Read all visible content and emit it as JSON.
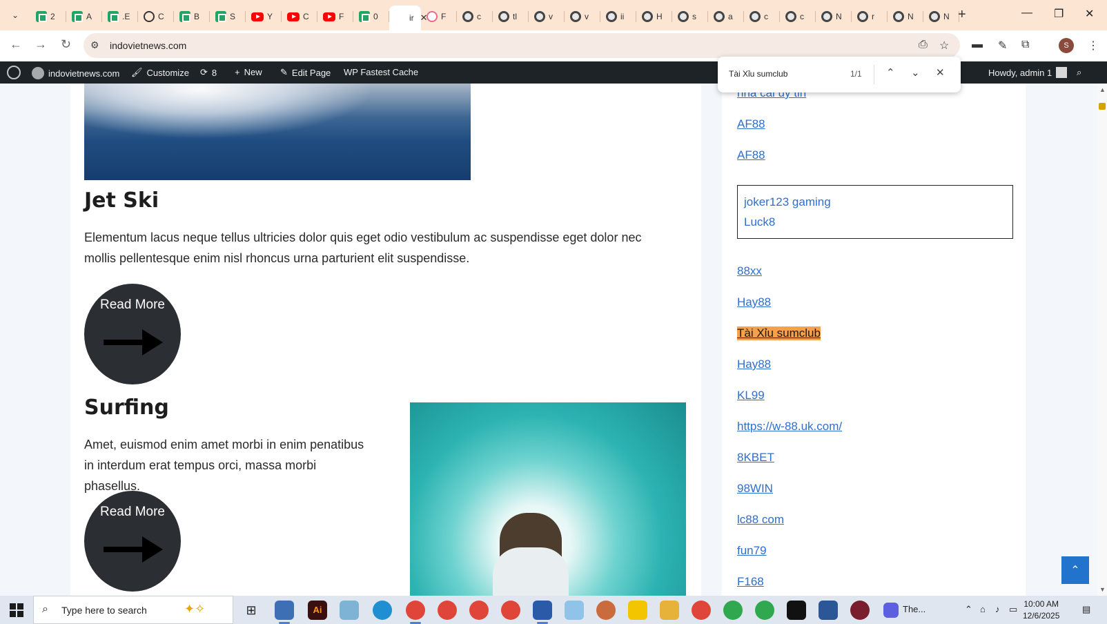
{
  "browser": {
    "tabs": [
      {
        "label": "2",
        "icon": "sheets-icon"
      },
      {
        "label": "A",
        "icon": "sheets-icon"
      },
      {
        "label": ".E",
        "icon": "sheets-icon"
      },
      {
        "label": "C",
        "icon": "chatgpt-icon"
      },
      {
        "label": "B",
        "icon": "sheets-icon"
      },
      {
        "label": "S",
        "icon": "sheets-icon"
      },
      {
        "label": "Y",
        "icon": "youtube-icon"
      },
      {
        "label": "C",
        "icon": "youtube-icon"
      },
      {
        "label": "F",
        "icon": "youtube-icon"
      },
      {
        "label": "0",
        "icon": "sheets-icon"
      },
      {
        "label": "ir",
        "icon": "page-icon",
        "active": true
      },
      {
        "label": "F",
        "icon": "pink-icon"
      },
      {
        "label": "c",
        "icon": "globe-icon"
      },
      {
        "label": "tl",
        "icon": "globe-icon"
      },
      {
        "label": "v",
        "icon": "globe-icon"
      },
      {
        "label": "v",
        "icon": "globe-icon"
      },
      {
        "label": "ii",
        "icon": "globe-icon"
      },
      {
        "label": "H",
        "icon": "globe-icon"
      },
      {
        "label": "s",
        "icon": "globe-icon"
      },
      {
        "label": "a",
        "icon": "globe-icon"
      },
      {
        "label": "c",
        "icon": "globe-icon"
      },
      {
        "label": "c",
        "icon": "globe-icon"
      },
      {
        "label": "N",
        "icon": "globe-icon"
      },
      {
        "label": "r",
        "icon": "globe-icon"
      },
      {
        "label": "N",
        "icon": "globe-icon"
      },
      {
        "label": "N",
        "icon": "globe-icon"
      }
    ],
    "tab_close": "✕",
    "new_tab": "+",
    "window_controls": {
      "minimize": "—",
      "restore": "❐",
      "close": "✕"
    },
    "address": "indovietnews.com",
    "menu_glyph": "⌄"
  },
  "adminbar": {
    "site": "indovietnews.com",
    "customize": "Customize",
    "updates": "8",
    "new": "New",
    "edit_page": "Edit Page",
    "cache": "WP Fastest Cache",
    "howdy": "Howdy, admin 1"
  },
  "findbar": {
    "query": "Tài Xỉu sumclub",
    "count": "1/1"
  },
  "main": {
    "posts": [
      {
        "title": "Jet Ski",
        "excerpt": "Elementum lacus neque tellus ultricies dolor quis eget odio vestibulum ac suspendisse eget dolor nec mollis pellentesque enim nisl rhoncus urna parturient elit suspendisse.",
        "read_more": "Read More"
      },
      {
        "title": "Surfing",
        "excerpt": "Amet, euismod enim amet morbi in enim penatibus in interdum erat tempus orci, massa morbi phasellus.",
        "read_more": "Read More"
      }
    ]
  },
  "sidebar": {
    "links": [
      "nha cai uy tin",
      "AF88",
      "AF88",
      "88xx",
      "Hay88",
      "Tài Xỉu sumclub",
      "Hay88",
      "KL99",
      "https://w-88.uk.com/",
      "8KBET",
      "98WIN",
      "lc88 com",
      "fun79",
      "F168"
    ],
    "box_links": [
      "joker123 gaming",
      "Luck8"
    ],
    "highlight_color": "#f5a04b",
    "link_color": "#2d6fcf"
  },
  "taskbar": {
    "search_placeholder": "Type here to search",
    "zoom_app_label": "The...",
    "time": "10:00 AM",
    "date": "12/6/2025"
  }
}
